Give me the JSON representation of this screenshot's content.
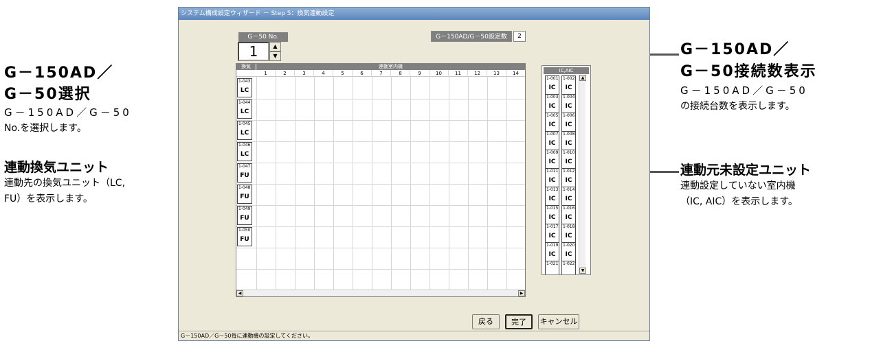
{
  "window": {
    "title": "システム構成設定ウィザード － Step 5：換気連動設定",
    "status": "G－150AD／G－50毎に連動機の設定してください。"
  },
  "g50_select": {
    "label": "G－50 No.",
    "value": "1",
    "up": "▲",
    "down": "▼"
  },
  "connection": {
    "label": "G－150AD/G－50設定数",
    "count": "2"
  },
  "grid": {
    "col_header_left": "換気",
    "col_header_right": "連動室内機",
    "columns": [
      "1",
      "2",
      "3",
      "4",
      "5",
      "6",
      "7",
      "8",
      "9",
      "10",
      "11",
      "12",
      "13",
      "14"
    ],
    "rows": [
      {
        "addr": "1-043",
        "type": "LC"
      },
      {
        "addr": "1-044",
        "type": "LC"
      },
      {
        "addr": "1-045",
        "type": "LC"
      },
      {
        "addr": "1-046",
        "type": "LC"
      },
      {
        "addr": "1-047",
        "type": "FU"
      },
      {
        "addr": "1-048",
        "type": "FU"
      },
      {
        "addr": "1-049",
        "type": "FU"
      },
      {
        "addr": "1-050",
        "type": "FU"
      }
    ],
    "scroll_left": "◀",
    "scroll_right": "▶"
  },
  "ic_panel": {
    "title": "IC,AIC",
    "units": [
      {
        "addr": "1-001",
        "type": "IC"
      },
      {
        "addr": "1-002",
        "type": "IC"
      },
      {
        "addr": "1-003",
        "type": "IC"
      },
      {
        "addr": "1-004",
        "type": "IC"
      },
      {
        "addr": "1-005",
        "type": "IC"
      },
      {
        "addr": "1-006",
        "type": "IC"
      },
      {
        "addr": "1-007",
        "type": "IC"
      },
      {
        "addr": "1-008",
        "type": "IC"
      },
      {
        "addr": "1-009",
        "type": "IC"
      },
      {
        "addr": "1-010",
        "type": "IC"
      },
      {
        "addr": "1-011",
        "type": "IC"
      },
      {
        "addr": "1-012",
        "type": "IC"
      },
      {
        "addr": "1-013",
        "type": "IC"
      },
      {
        "addr": "1-014",
        "type": "IC"
      },
      {
        "addr": "1-015",
        "type": "IC"
      },
      {
        "addr": "1-016",
        "type": "IC"
      },
      {
        "addr": "1-017",
        "type": "IC"
      },
      {
        "addr": "1-018",
        "type": "IC"
      },
      {
        "addr": "1-019",
        "type": "IC"
      },
      {
        "addr": "1-020",
        "type": "IC"
      },
      {
        "addr": "1-021",
        "type": ""
      },
      {
        "addr": "1-022",
        "type": ""
      }
    ],
    "scroll_up": "▲",
    "scroll_down": "▼"
  },
  "buttons": {
    "back": "戻る",
    "finish": "完了",
    "cancel": "キャンセル"
  },
  "annotations": {
    "g50_select": {
      "title1": "G－150AD／",
      "title2": "G－50選択",
      "desc1": "G－150AD／G－50",
      "desc2": "No.を選択します。"
    },
    "linked_vent": {
      "title": "連動換気ユニット",
      "desc1": "連動先の換気ユニット（LC,",
      "desc2": "FU）を表示します。"
    },
    "conn_count": {
      "title1": "G－150AD／",
      "title2": "G－50接続数表示",
      "desc1": "G－150AD／G－50",
      "desc2": "の接続台数を表示します。"
    },
    "unset_source": {
      "title": "連動元未設定ユニット",
      "desc1": "連動設定していない室内機",
      "desc2": "（IC, AIC）を表示します。"
    }
  }
}
